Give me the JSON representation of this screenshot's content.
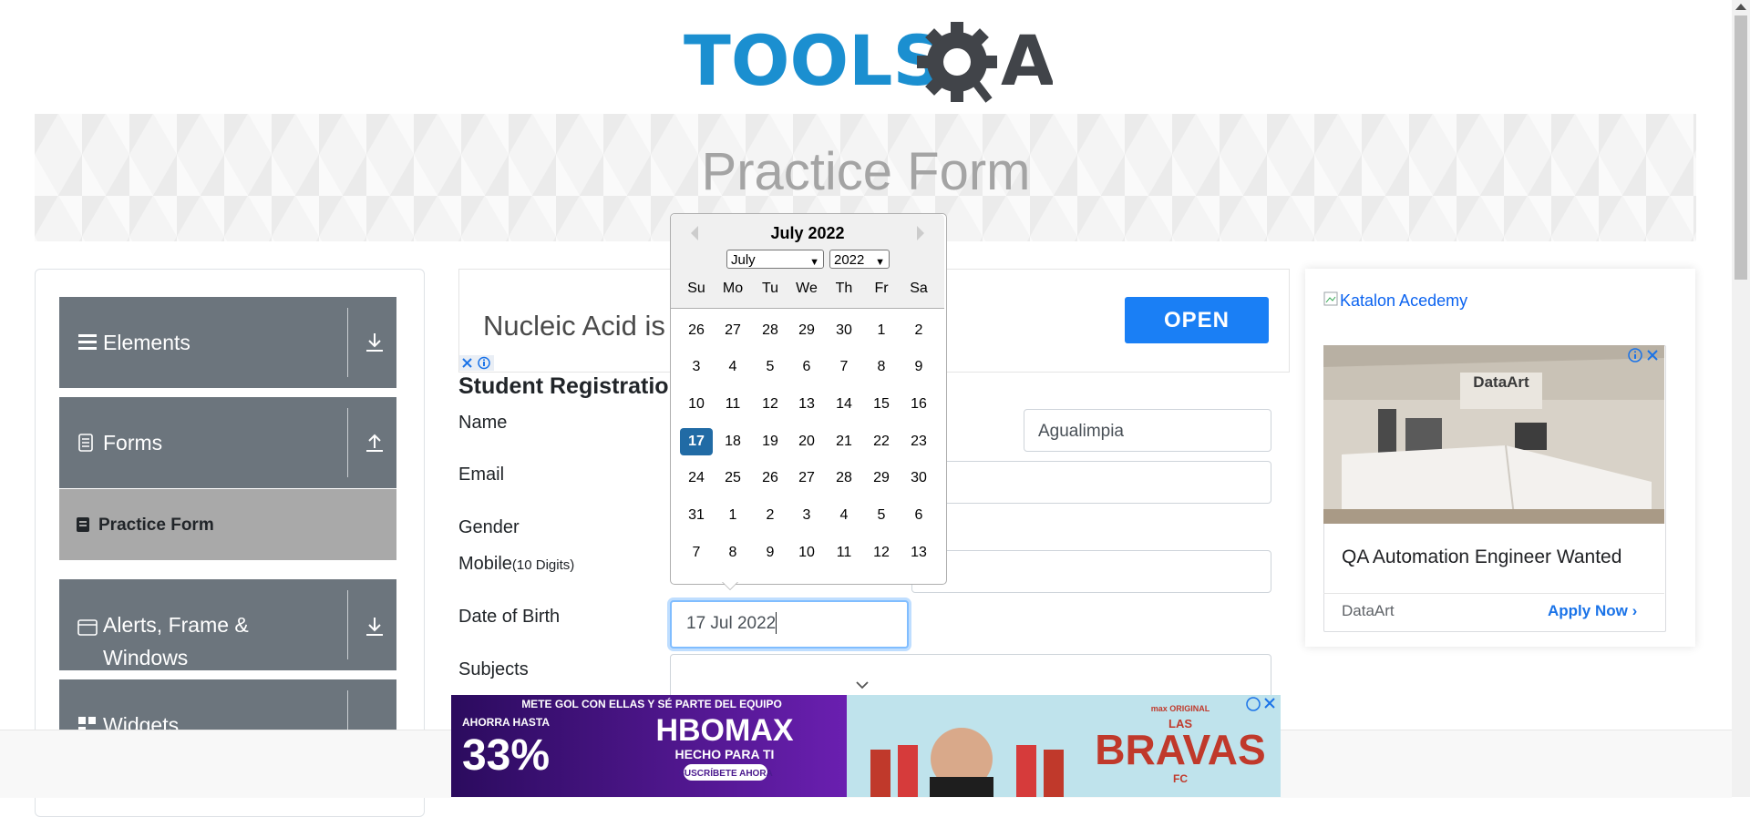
{
  "logo": {
    "text_left": "TOOLS",
    "text_right": "A"
  },
  "header": {
    "title": "Practice Form"
  },
  "sidebar": {
    "groups": [
      {
        "label": "Elements",
        "icon": "hamburger-icon",
        "arrow": "download-icon"
      },
      {
        "label": "Forms",
        "icon": "document-icon",
        "arrow": "upload-icon"
      },
      {
        "label": "Alerts, Frame &",
        "label2": "Windows",
        "icon": "window-icon",
        "arrow": "download-icon"
      },
      {
        "label": "Widgets",
        "icon": "widgets-icon",
        "arrow": "download-icon"
      }
    ],
    "active_item": "Practice Form"
  },
  "top_ad": {
    "text": "Nucleic Acid is",
    "button": "OPEN"
  },
  "form": {
    "heading": "Student Registration",
    "labels": {
      "name": "Name",
      "email": "Email",
      "gender": "Gender",
      "mobile": "Mobile",
      "mobile_hint": "(10 Digits)",
      "dob": "Date of Birth",
      "subjects": "Subjects"
    },
    "last_name_value": "Agualimpia",
    "dob_value": "17 Jul 2022"
  },
  "datepicker": {
    "title": "July 2022",
    "month_select": "July",
    "year_select": "2022",
    "day_names": [
      "Su",
      "Mo",
      "Tu",
      "We",
      "Th",
      "Fr",
      "Sa"
    ],
    "weeks": [
      [
        "26",
        "27",
        "28",
        "29",
        "30",
        "1",
        "2"
      ],
      [
        "3",
        "4",
        "5",
        "6",
        "7",
        "8",
        "9"
      ],
      [
        "10",
        "11",
        "12",
        "13",
        "14",
        "15",
        "16"
      ],
      [
        "17",
        "18",
        "19",
        "20",
        "21",
        "22",
        "23"
      ],
      [
        "24",
        "25",
        "26",
        "27",
        "28",
        "29",
        "30"
      ],
      [
        "31",
        "1",
        "2",
        "3",
        "4",
        "5",
        "6"
      ],
      [
        "7",
        "8",
        "9",
        "10",
        "11",
        "12",
        "13"
      ]
    ],
    "selected": "17"
  },
  "right_ad": {
    "link": "Katalon Acedemy",
    "brand_logo": "DataArt",
    "title": "QA Automation Engineer Wanted",
    "brand": "DataArt",
    "cta": "Apply Now"
  },
  "bottom_ad": {
    "line1": "METE GOL CON ELLAS Y SÉ PARTE DEL EQUIPO",
    "line2": "AHORRA HASTA",
    "percent": "33%",
    "brand": "HBOMAX",
    "tagline": "HECHO PARA TI",
    "cta": "SUSCRÍBETE AHORA",
    "show_top": "max ORIGINAL",
    "show_las": "LAS",
    "show": "BRAVAS",
    "show_sub": "FC"
  },
  "colors": {
    "sidebar_group": "#6c757d",
    "active_item": "#a9a9a9",
    "accent": "#1a7ff5",
    "selected_day": "#216ba5"
  }
}
